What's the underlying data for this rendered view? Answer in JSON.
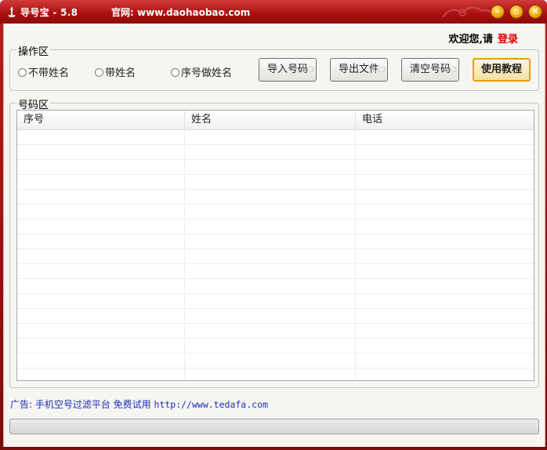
{
  "window": {
    "title": "导号宝 - 5.8",
    "site": "官网: www.daohaobao.com",
    "minimize_glyph": "–",
    "maximize_glyph": "▫",
    "close_glyph": "✕",
    "accent": "#a90f0f"
  },
  "header": {
    "welcome": "欢迎您,请",
    "login": "登录"
  },
  "ops": {
    "group_label": "操作区",
    "radios": [
      "不带姓名",
      "带姓名",
      "序号做姓名"
    ],
    "buttons": {
      "import": "导入号码",
      "export": "导出文件",
      "clear": "清空号码",
      "help": "使用教程"
    }
  },
  "numbers": {
    "group_label": "号码区",
    "columns": [
      "序号",
      "姓名",
      "电话"
    ]
  },
  "ad": {
    "prefix": "广告: 手机空号过滤平台 免费试用",
    "url": "http://www.tedafa.com"
  }
}
